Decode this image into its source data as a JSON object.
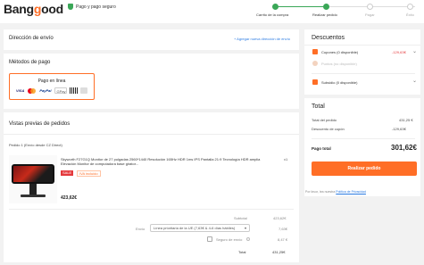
{
  "brand": {
    "logo_left": "Bang",
    "logo_o": "g",
    "logo_right": "ood",
    "secure_text": "Pago y pago seguro",
    "accent": "#ff6e26",
    "green": "#3aa757"
  },
  "steps": [
    {
      "label": "Carrito de la compra",
      "state": "done"
    },
    {
      "label": "Realizar pedido",
      "state": "done"
    },
    {
      "label": "Pagar",
      "state": "todo"
    },
    {
      "label": "Éxito",
      "state": "todo"
    }
  ],
  "address": {
    "title": "Dirección de envío",
    "add_link": "+ Agregar nueva dirección de envío"
  },
  "payment": {
    "title": "Métodos de pago",
    "option_title": "Pago en línea",
    "logos": [
      "VISA",
      "MC",
      "PayPal",
      "GPay",
      "Boleto"
    ]
  },
  "preview": {
    "title": "Vistas previas de pedidos",
    "package_label": "Pedido 1 (Envío desde CZ Direct)",
    "product": {
      "name": "Skyworth F27G1Q Monitor de 27 pulgadas 2560*1440 Resolución 165Hz HDR 1ms IPS Pantalla 21:9 Tecnología HDR amplia Elevación Monitor de computadora base girator...",
      "qty": "x1",
      "sale_tag": "SALE",
      "vat_tag": "IVA incluido",
      "price": "423,62€"
    },
    "subtotal_label": "Subtotal",
    "subtotal_value": "423,62€",
    "shipping_label": "Envío",
    "shipping_option": "Línea prioritaria de la UE (7,63€ & 4-6 días hábiles)",
    "shipping_value": "7,63€",
    "insurance_label": "Seguro de envío",
    "insurance_value": "8,47 €",
    "total_label": "Total",
    "total_value": "431,25€"
  },
  "discounts": {
    "title": "Descuentos",
    "coupons_label": "Cupones (0 disponible)",
    "coupons_value": "-129,63€",
    "points_label": "Puntos (no disponible)",
    "subsidy_label": "Subsidio (0 disponible)"
  },
  "totals": {
    "title": "Total",
    "order_total_label": "Total del pedido",
    "order_total_value": "431,25 €",
    "coupon_discount_label": "Descuento de cupón",
    "coupon_discount_value": "-129,63€",
    "payable_label": "Pago total",
    "payable_value": "301,62€",
    "place_order_label": "Realizar pedido",
    "policy_prefix": "Por favor, lea nuestra",
    "policy_link": "Política de Privacidad"
  }
}
